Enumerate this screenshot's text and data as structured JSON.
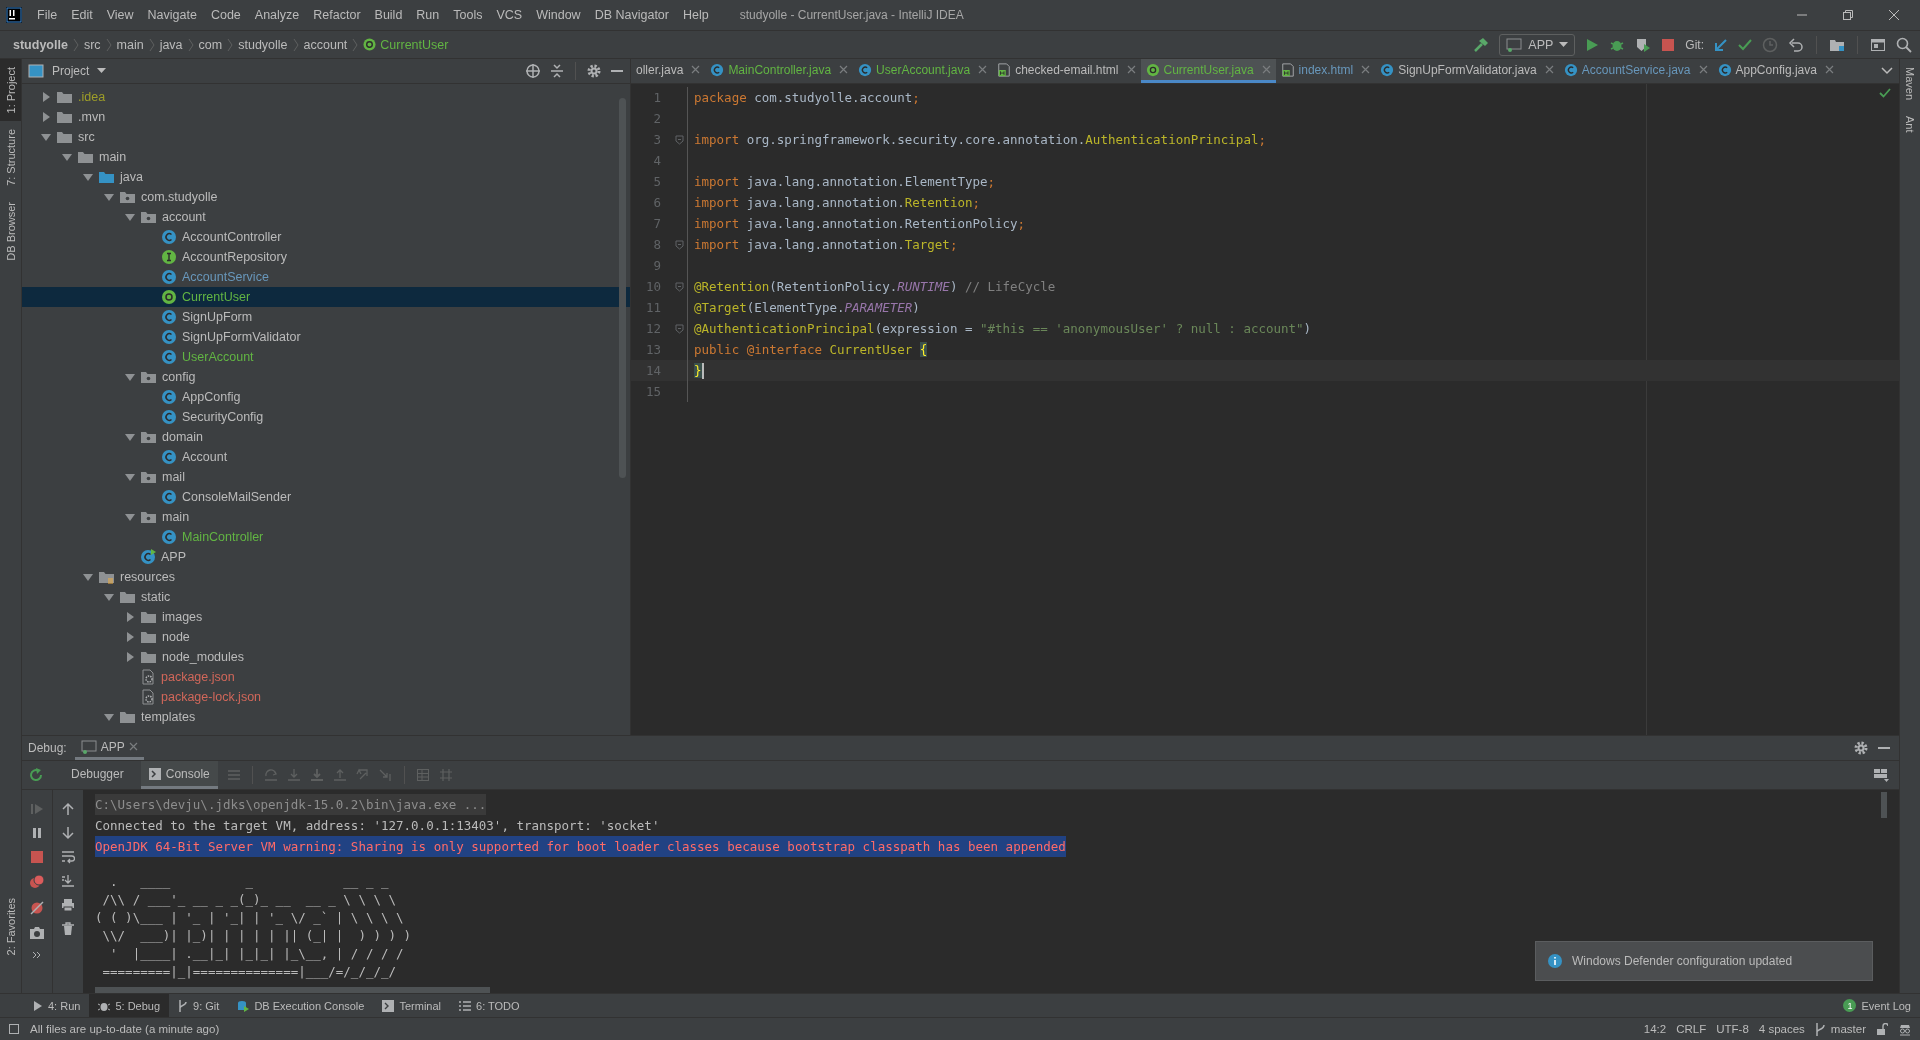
{
  "window": {
    "title": "studyolle - CurrentUser.java - IntelliJ IDEA"
  },
  "menu": [
    "File",
    "Edit",
    "View",
    "Navigate",
    "Code",
    "Analyze",
    "Refactor",
    "Build",
    "Run",
    "Tools",
    "VCS",
    "Window",
    "DB Navigator",
    "Help"
  ],
  "breadcrumbs": [
    {
      "label": "studyolle",
      "kind": "project"
    },
    {
      "label": "src",
      "kind": "folder"
    },
    {
      "label": "main",
      "kind": "folder"
    },
    {
      "label": "java",
      "kind": "folder"
    },
    {
      "label": "com",
      "kind": "folder"
    },
    {
      "label": "studyolle",
      "kind": "folder"
    },
    {
      "label": "account",
      "kind": "folder"
    },
    {
      "label": "CurrentUser",
      "kind": "annotation"
    }
  ],
  "toolbar": {
    "run_config": "APP",
    "git_label": "Git:"
  },
  "left_stripe": [
    {
      "label": "1: Project",
      "selected": true
    },
    {
      "label": "7: Structure",
      "selected": false
    },
    {
      "label": "DB Browser",
      "selected": false
    }
  ],
  "left_stripe_bottom": [
    {
      "label": "2: Favorites",
      "selected": false
    }
  ],
  "right_stripe": [
    {
      "label": "Maven"
    },
    {
      "label": "Ant"
    }
  ],
  "project_tree": {
    "title": "Project",
    "items": [
      {
        "label": ".idea",
        "kind": "folder",
        "color": "#9e9e28",
        "expanded": false,
        "selected": false
      },
      {
        "label": ".mvn",
        "kind": "folder",
        "color": "#bbbbbb",
        "expanded": false,
        "selected": false
      },
      {
        "label": "src",
        "kind": "folder",
        "color": "#bbbbbb",
        "expanded": true,
        "selected": false,
        "children": [
          {
            "label": "main",
            "kind": "folder",
            "color": "#bbbbbb",
            "expanded": true,
            "selected": false,
            "children": [
              {
                "label": "java",
                "kind": "source-folder",
                "color": "#bbbbbb",
                "expanded": true,
                "selected": false,
                "children": [
                  {
                    "label": "com.studyolle",
                    "kind": "package",
                    "color": "#bbbbbb",
                    "expanded": true,
                    "selected": false,
                    "children": [
                      {
                        "label": "account",
                        "kind": "package",
                        "color": "#bbbbbb",
                        "expanded": true,
                        "selected": false,
                        "children": [
                          {
                            "label": "AccountController",
                            "kind": "class",
                            "color": "#bbbbbb",
                            "selected": false
                          },
                          {
                            "label": "AccountRepository",
                            "kind": "interface",
                            "color": "#bbbbbb",
                            "selected": false
                          },
                          {
                            "label": "AccountService",
                            "kind": "class",
                            "color": "#6897bb",
                            "selected": false
                          },
                          {
                            "label": "CurrentUser",
                            "kind": "annotation",
                            "color": "#62b543",
                            "selected": true
                          },
                          {
                            "label": "SignUpForm",
                            "kind": "class",
                            "color": "#bbbbbb",
                            "selected": false
                          },
                          {
                            "label": "SignUpFormValidator",
                            "kind": "class",
                            "color": "#bbbbbb",
                            "selected": false
                          },
                          {
                            "label": "UserAccount",
                            "kind": "class",
                            "color": "#62b543",
                            "selected": false
                          }
                        ]
                      },
                      {
                        "label": "config",
                        "kind": "package",
                        "color": "#bbbbbb",
                        "expanded": true,
                        "selected": false,
                        "children": [
                          {
                            "label": "AppConfig",
                            "kind": "class",
                            "color": "#bbbbbb",
                            "selected": false
                          },
                          {
                            "label": "SecurityConfig",
                            "kind": "class",
                            "color": "#bbbbbb",
                            "selected": false
                          }
                        ]
                      },
                      {
                        "label": "domain",
                        "kind": "package",
                        "color": "#bbbbbb",
                        "expanded": true,
                        "selected": false,
                        "children": [
                          {
                            "label": "Account",
                            "kind": "class",
                            "color": "#bbbbbb",
                            "selected": false
                          }
                        ]
                      },
                      {
                        "label": "mail",
                        "kind": "package",
                        "color": "#bbbbbb",
                        "expanded": true,
                        "selected": false,
                        "children": [
                          {
                            "label": "ConsoleMailSender",
                            "kind": "class",
                            "color": "#bbbbbb",
                            "selected": false
                          }
                        ]
                      },
                      {
                        "label": "main",
                        "kind": "package",
                        "color": "#bbbbbb",
                        "expanded": true,
                        "selected": false,
                        "children": [
                          {
                            "label": "MainController",
                            "kind": "class",
                            "color": "#62b543",
                            "selected": false
                          }
                        ]
                      },
                      {
                        "label": "APP",
                        "kind": "app",
                        "color": "#bbbbbb",
                        "selected": false
                      }
                    ]
                  }
                ]
              },
              {
                "label": "resources",
                "kind": "resources",
                "color": "#bbbbbb",
                "expanded": true,
                "selected": false,
                "children": [
                  {
                    "label": "static",
                    "kind": "folder",
                    "color": "#bbbbbb",
                    "expanded": true,
                    "selected": false,
                    "children": [
                      {
                        "label": "images",
                        "kind": "folder",
                        "color": "#bbbbbb",
                        "expanded": false,
                        "selected": false
                      },
                      {
                        "label": "node",
                        "kind": "folder",
                        "color": "#bbbbbb",
                        "expanded": false,
                        "selected": false
                      },
                      {
                        "label": "node_modules",
                        "kind": "folder",
                        "color": "#bbbbbb",
                        "expanded": false,
                        "selected": false
                      },
                      {
                        "label": "package.json",
                        "kind": "json",
                        "color": "#d1675a",
                        "selected": false
                      },
                      {
                        "label": "package-lock.json",
                        "kind": "json",
                        "color": "#d1675a",
                        "selected": false
                      }
                    ]
                  },
                  {
                    "label": "templates",
                    "kind": "folder",
                    "color": "#bbbbbb",
                    "expanded": true,
                    "selected": false
                  }
                ]
              }
            ]
          }
        ]
      }
    ]
  },
  "editor_tabs": [
    {
      "label": "oller.java",
      "kind": "none",
      "color": "#bbbbbb",
      "selected": false
    },
    {
      "label": "MainController.java",
      "kind": "class",
      "color": "#62b543",
      "selected": false
    },
    {
      "label": "UserAccount.java",
      "kind": "class",
      "color": "#62b543",
      "selected": false
    },
    {
      "label": "checked-email.html",
      "kind": "html",
      "color": "#bbbbbb",
      "selected": false
    },
    {
      "label": "CurrentUser.java",
      "kind": "annotation",
      "color": "#62b543",
      "selected": true
    },
    {
      "label": "index.html",
      "kind": "html",
      "color": "#6897bb",
      "selected": false
    },
    {
      "label": "SignUpFormValidator.java",
      "kind": "class",
      "color": "#bbbbbb",
      "selected": false
    },
    {
      "label": "AccountService.java",
      "kind": "class",
      "color": "#6897bb",
      "selected": false
    },
    {
      "label": "AppConfig.java",
      "kind": "class",
      "color": "#bbbbbb",
      "selected": false
    }
  ],
  "code": [
    {
      "number": "1",
      "current": false,
      "fold": false,
      "tokens": [
        {
          "kind": "keyword",
          "text": "package"
        },
        {
          "kind": "plain",
          "text": " com.studyolle.account"
        },
        {
          "kind": "keyword",
          "text": ";"
        }
      ]
    },
    {
      "number": "2",
      "current": false,
      "fold": false
    },
    {
      "number": "3",
      "current": false,
      "fold": true,
      "tokens": [
        {
          "kind": "keyword",
          "text": "import"
        },
        {
          "kind": "plain",
          "text": " org.springframework.security.core.annotation."
        },
        {
          "kind": "annotation",
          "text": "AuthenticationPrincipal"
        },
        {
          "kind": "keyword",
          "text": ";"
        }
      ]
    },
    {
      "number": "4",
      "current": false,
      "fold": false
    },
    {
      "number": "5",
      "current": false,
      "fold": false,
      "tokens": [
        {
          "kind": "keyword",
          "text": "import"
        },
        {
          "kind": "plain",
          "text": " java.lang.annotation.ElementType"
        },
        {
          "kind": "keyword",
          "text": ";"
        }
      ]
    },
    {
      "number": "6",
      "current": false,
      "fold": false,
      "tokens": [
        {
          "kind": "keyword",
          "text": "import"
        },
        {
          "kind": "plain",
          "text": " java.lang.annotation."
        },
        {
          "kind": "annotation",
          "text": "Retention"
        },
        {
          "kind": "keyword",
          "text": ";"
        }
      ]
    },
    {
      "number": "7",
      "current": false,
      "fold": false,
      "tokens": [
        {
          "kind": "keyword",
          "text": "import"
        },
        {
          "kind": "plain",
          "text": " java.lang.annotation.RetentionPolicy"
        },
        {
          "kind": "keyword",
          "text": ";"
        }
      ]
    },
    {
      "number": "8",
      "current": false,
      "fold": true,
      "tokens": [
        {
          "kind": "keyword",
          "text": "import"
        },
        {
          "kind": "plain",
          "text": " java.lang.annotation."
        },
        {
          "kind": "annotation",
          "text": "Target"
        },
        {
          "kind": "keyword",
          "text": ";"
        }
      ]
    },
    {
      "number": "9",
      "current": false,
      "fold": false
    },
    {
      "number": "10",
      "current": false,
      "fold": true,
      "tokens": [
        {
          "kind": "annotation",
          "text": "@Retention"
        },
        {
          "kind": "plain",
          "text": "(RetentionPolicy."
        },
        {
          "kind": "constant",
          "text": "RUNTIME"
        },
        {
          "kind": "plain",
          "text": ") "
        },
        {
          "kind": "comment",
          "text": "// LifeCycle"
        }
      ]
    },
    {
      "number": "11",
      "current": false,
      "fold": false,
      "tokens": [
        {
          "kind": "annotation",
          "text": "@Target"
        },
        {
          "kind": "plain",
          "text": "(ElementType."
        },
        {
          "kind": "constant",
          "text": "PARAMETER"
        },
        {
          "kind": "plain",
          "text": ")"
        }
      ]
    },
    {
      "number": "12",
      "current": false,
      "fold": true,
      "tokens": [
        {
          "kind": "annotation",
          "text": "@AuthenticationPrincipal"
        },
        {
          "kind": "plain",
          "text": "(expression = "
        },
        {
          "kind": "string",
          "text": "\"#this == 'anonymousUser' ? null : account\""
        },
        {
          "kind": "plain",
          "text": ")"
        }
      ]
    },
    {
      "number": "13",
      "current": false,
      "fold": false,
      "tokens": [
        {
          "kind": "keyword",
          "text": "public "
        },
        {
          "kind": "keyword",
          "text": "@interface "
        },
        {
          "kind": "annotation",
          "text": "CurrentUser "
        },
        {
          "kind": "brace",
          "text": "{"
        }
      ]
    },
    {
      "number": "14",
      "current": true,
      "fold": false,
      "tokens": [
        {
          "kind": "brace",
          "text": "}"
        }
      ]
    },
    {
      "number": "15",
      "current": false,
      "fold": false
    }
  ],
  "debug": {
    "label": "Debug:",
    "tabs": [
      {
        "label": "APP",
        "selected": true
      }
    ],
    "subtabs": [
      {
        "label": "Debugger",
        "selected": false
      },
      {
        "label": "Console",
        "selected": true
      }
    ],
    "console": [
      {
        "kind": "command",
        "text": "C:\\Users\\devju\\.jdks\\openjdk-15.0.2\\bin\\java.exe ..."
      },
      {
        "kind": "output",
        "text": "Connected to the target VM, address: '127.0.0.1:13403', transport: 'socket'"
      },
      {
        "kind": "warning",
        "text": "OpenJDK 64-Bit Server VM warning: Sharing is only supported for boot loader classes because bootstrap classpath has been appended"
      }
    ],
    "banner": [
      "  .   ____          _            __ _ _",
      " /\\\\ / ___'_ __ _ _(_)_ __  __ _ \\ \\ \\ \\",
      "( ( )\\___ | '_ | '_| | '_ \\/ _` | \\ \\ \\ \\",
      " \\\\/  ___)| |_)| | | | | || (_| |  ) ) ) )",
      "  '  |____| .__|_| |_|_| |_\\__, | / / / /",
      " =========|_|==============|___/=/_/_/_/"
    ]
  },
  "notification": {
    "text": "Windows Defender configuration updated"
  },
  "tool_windows": [
    {
      "label": "4: Run",
      "kind": "run",
      "selected": false
    },
    {
      "label": "5: Debug",
      "kind": "debug",
      "selected": true
    },
    {
      "label": "9: Git",
      "kind": "git",
      "selected": false
    },
    {
      "label": "DB Execution Console",
      "kind": "db",
      "selected": false
    },
    {
      "label": "Terminal",
      "kind": "terminal",
      "selected": false
    },
    {
      "label": "6: TODO",
      "kind": "todo",
      "selected": false
    }
  ],
  "event_log": {
    "label": "Event Log",
    "count": "1"
  },
  "status_bar": {
    "message": "All files are up-to-date (a minute ago)",
    "position": "14:2",
    "line_separator": "CRLF",
    "encoding": "UTF-8",
    "indent": "4 spaces",
    "branch": "master"
  }
}
